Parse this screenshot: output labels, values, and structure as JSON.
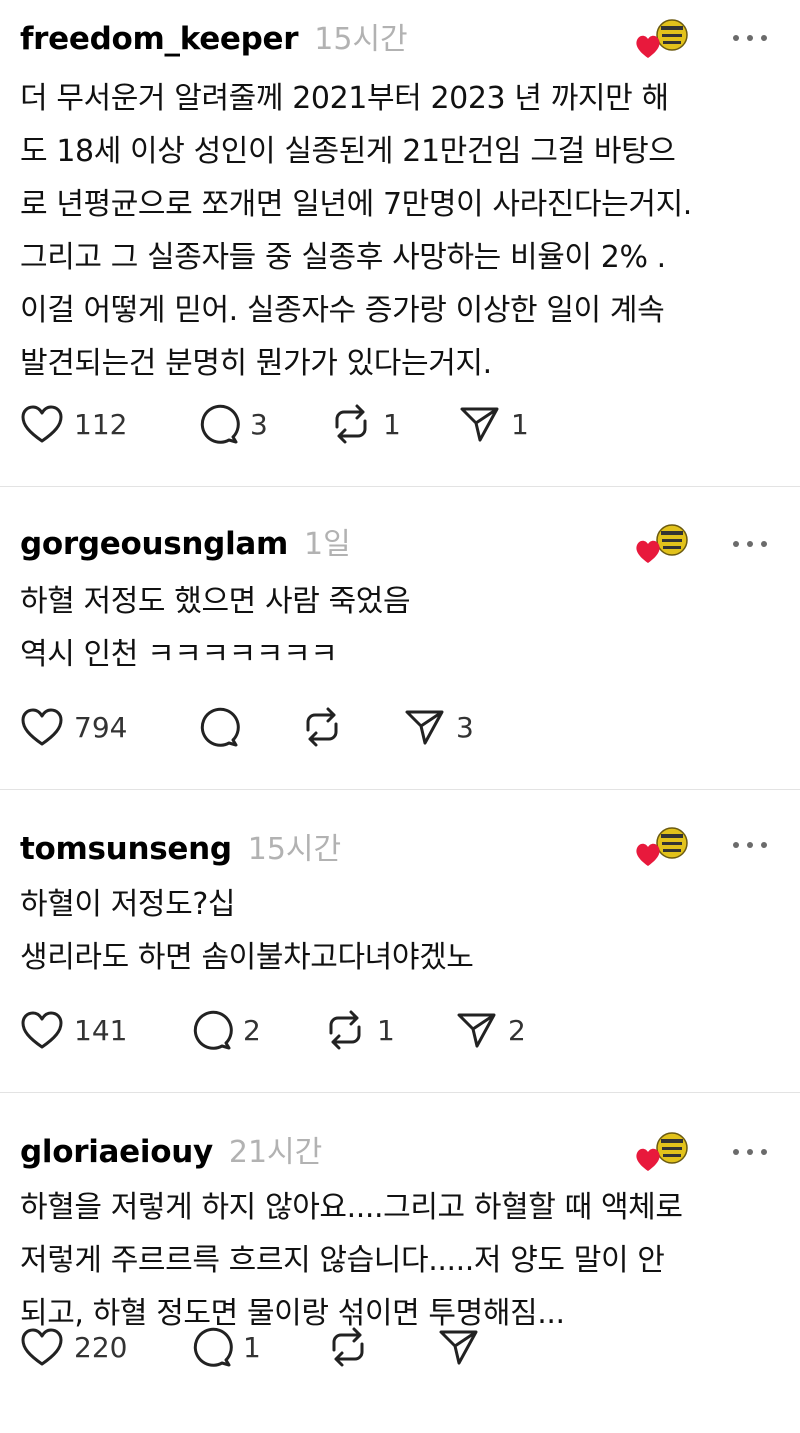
{
  "posts": [
    {
      "username": "freedom_keeper",
      "time": "15시간",
      "text": "더 무서운거 알려줄께 2021부터 2023 년 까지만 해\n도 18세 이상 성인이 실종된게 21만건임 그걸 바탕으\n로 년평균으로 쪼개면 일년에 7만명이 사라진다는거지.\n그리고 그 실종자들 중 실종후 사망하는 비율이 2% .\n이걸 어떻게 믿어. 실종자수 증가랑 이상한 일이 계속\n발견되는건 분명히 뭔가가 있다는거지.",
      "likes": "112",
      "replies": "3",
      "reposts": "1",
      "shares": "1"
    },
    {
      "username": "gorgeousnglam",
      "time": "1일",
      "text": "하혈 저정도 했으면 사람 죽었음\n역시 인천 ㅋㅋㅋㅋㅋㅋㅋ",
      "likes": "794",
      "replies": "",
      "reposts": "",
      "shares": "3"
    },
    {
      "username": "tomsunseng",
      "time": "15시간",
      "text": "하혈이 저정도?십\n생리라도 하면 솜이불차고다녀야겠노",
      "likes": "141",
      "replies": "2",
      "reposts": "1",
      "shares": "2"
    },
    {
      "username": "gloriaeiouy",
      "time": "21시간",
      "text": "하혈을 저렇게 하지 않아요....그리고 하혈할 때 액체로\n저렇게 주르르륵 흐르지 않습니다.....저 양도 말이 안\n되고, 하혈 정도면 물이랑 섞이면 투명해짐...",
      "likes": "220",
      "replies": "1",
      "reposts": "",
      "shares": ""
    }
  ],
  "icons": {
    "like": "heart-outline-icon",
    "reply": "speech-bubble-icon",
    "repost": "repost-arrows-icon",
    "share": "paper-plane-icon",
    "more": "more-dots-icon",
    "badge": "liked-by-author-badge"
  },
  "colors": {
    "heart_red": "#e8193c",
    "time_gray": "#b2b2b2",
    "badge_gold": "#e2c21b"
  }
}
